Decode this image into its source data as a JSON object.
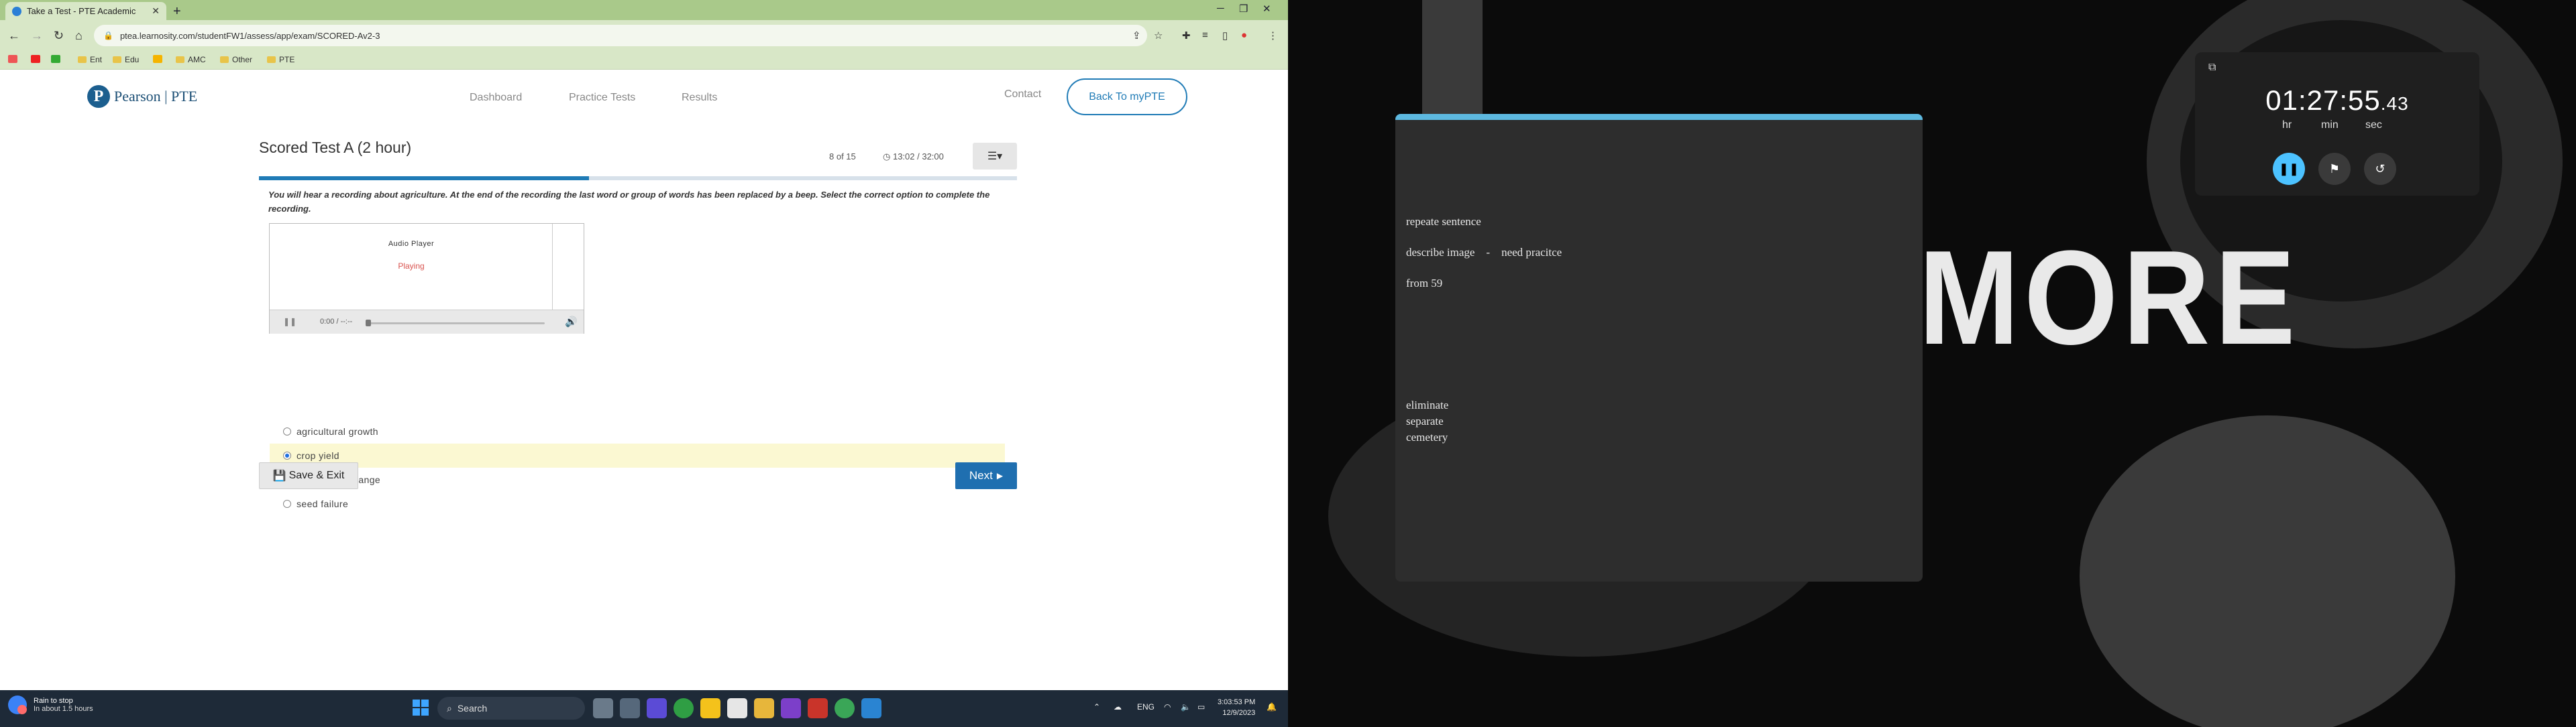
{
  "browser": {
    "tab_title": "Take a Test - PTE Academic",
    "new_tab": "+",
    "url": "ptea.learnosity.com/studentFW1/assess/app/exam/SCORED-Av2-3",
    "bookmarks": [
      "Ent",
      "Edu",
      "AMC",
      "Other",
      "PTE"
    ]
  },
  "site": {
    "logo_letter": "P",
    "logo_text": "Pearson | PTE",
    "nav": [
      "Dashboard",
      "Practice Tests",
      "Results"
    ],
    "contact": "Contact",
    "back_button": "Back To myPTE"
  },
  "test": {
    "title": "Scored Test A (2 hour)",
    "counter": "8 of 15",
    "timer": "13:02 / 32:00",
    "progress_fraction": 0.435,
    "instructions": "You will hear a recording about agriculture. At the end of the recording the last word or group of words has been replaced by a beep. Select the correct option to complete the recording.",
    "player": {
      "title": "Audio Player",
      "status": "Playing",
      "time": "0:00 / --:--"
    },
    "options": [
      {
        "label": "agricultural growth",
        "selected": false
      },
      {
        "label": "crop yield",
        "selected": true
      },
      {
        "label": "currency exchange",
        "selected": false
      },
      {
        "label": "seed failure",
        "selected": false
      }
    ],
    "save_button": "Save & Exit",
    "next_button": "Next"
  },
  "taskbar": {
    "weather_line1": "Rain to stop",
    "weather_line2": "In about 1.5 hours",
    "search": "Search",
    "lang": "ENG",
    "time": "3:03:53 PM",
    "date": "12/9/2023"
  },
  "notes": {
    "lines": [
      "repeate sentence",
      "describe image    -    need pracitce",
      "from 59",
      "eliminate",
      "separate",
      "cemetery"
    ]
  },
  "background": {
    "word": "MORE"
  },
  "stopwatch": {
    "time_main": "01:27:55",
    "time_ms": ".43",
    "units": [
      "hr",
      "min",
      "sec"
    ]
  }
}
